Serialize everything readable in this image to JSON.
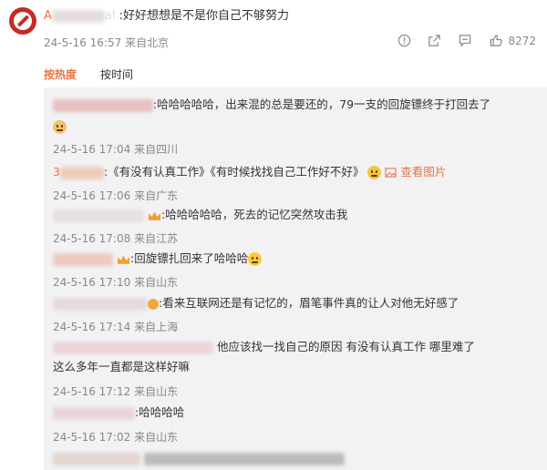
{
  "post": {
    "username_fragment": "A",
    "username_tail": "al",
    "text": ":好好想想是不是你自己不够努力",
    "datetime": "24-5-16 16:57",
    "location": "来自北京",
    "likes": "8272"
  },
  "tabs": {
    "hot": "按热度",
    "time": "按时间"
  },
  "comments": [
    {
      "prefix": "",
      "text": ":哈哈哈哈哈，出来混的总是要还的，79一支的回旋镖终于打回去了",
      "datetime": "24-5-16 17:04",
      "location": "来自四川"
    },
    {
      "prefix": "3",
      "text": ":《有没有认真工作》《有时候找找自己工作好不好》",
      "view_image": "查看图片",
      "datetime": "24-5-16 17:06",
      "location": "来自广东"
    },
    {
      "prefix": "",
      "text": ":哈哈哈哈哈，死去的记忆突然攻击我",
      "datetime": "24-5-16 17:08",
      "location": "来自江苏"
    },
    {
      "prefix": "",
      "text": ":回旋镖扎回来了哈哈哈",
      "datetime": "24-5-16 17:10",
      "location": "来自山东"
    },
    {
      "prefix": "",
      "text": ":看来互联网还是有记忆的，眉笔事件真的让人对他无好感了",
      "datetime": "24-5-16 17:14",
      "location": "来自上海"
    },
    {
      "prefix": "",
      "text": "他应该找一找自己的原因 有没有认真工作  哪里难了",
      "text_line2": "这么多年一直都是这样好嘛",
      "datetime": "24-5-16 17:12",
      "location": "来自山东"
    },
    {
      "prefix": "",
      "text": ":哈哈哈哈",
      "datetime": "24-5-16 17:02",
      "location": "来自山东"
    }
  ],
  "icons": [
    "report-icon",
    "share-icon",
    "comment-icon",
    "like-icon"
  ],
  "colors": {
    "accent": "#eb7340",
    "avatar": "#c62a24",
    "panel": "#f2f2f5"
  }
}
